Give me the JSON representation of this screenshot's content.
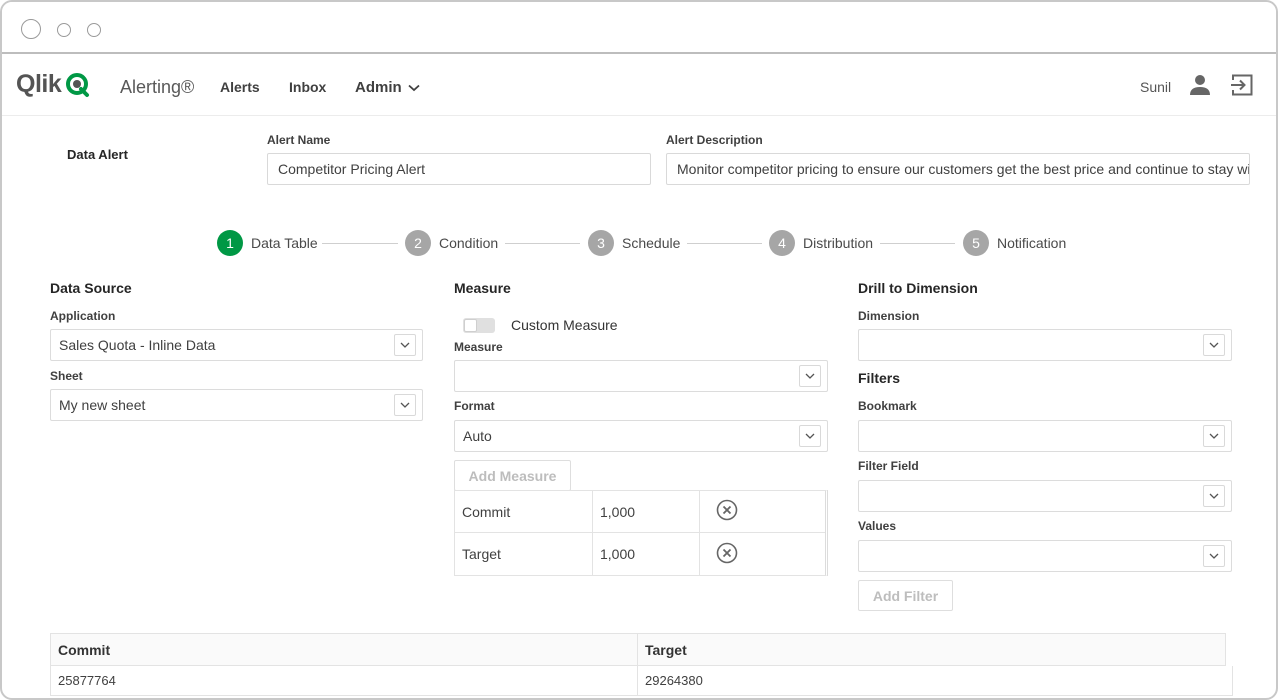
{
  "window": {
    "controls": [
      "close",
      "minimize",
      "maximize"
    ]
  },
  "navbar": {
    "brand": "Qlik",
    "app_name": "Alerting®",
    "links": {
      "alerts": "Alerts",
      "inbox": "Inbox",
      "admin": "Admin"
    },
    "user_name": "Sunil",
    "icons": {
      "user": "user-icon",
      "logout": "logout-icon",
      "admin_chevron": "chevron-down-icon"
    },
    "brand_color": "#009845"
  },
  "alert": {
    "type_label": "Data Alert",
    "name_label": "Alert Name",
    "name_value": "Competitor Pricing Alert",
    "description_label": "Alert Description",
    "description_value": "Monitor competitor pricing to ensure our customers get the best price and continue to stay wi"
  },
  "stepper": {
    "steps": [
      {
        "number": "1",
        "label": "Data Table",
        "active": true
      },
      {
        "number": "2",
        "label": "Condition",
        "active": false
      },
      {
        "number": "3",
        "label": "Schedule",
        "active": false
      },
      {
        "number": "4",
        "label": "Distribution",
        "active": false
      },
      {
        "number": "5",
        "label": "Notification",
        "active": false
      }
    ],
    "active_color": "#009845",
    "inactive_color": "#a6a6a6"
  },
  "data_source": {
    "heading": "Data Source",
    "application_label": "Application",
    "application_value": "Sales Quota - Inline Data",
    "sheet_label": "Sheet",
    "sheet_value": "My new sheet"
  },
  "measure": {
    "heading": "Measure",
    "custom_measure_label": "Custom Measure",
    "custom_measure_on": false,
    "measure_label": "Measure",
    "measure_value": "",
    "format_label": "Format",
    "format_value": "Auto",
    "add_button": "Add Measure",
    "rows": [
      {
        "name": "Commit",
        "value": "1,000"
      },
      {
        "name": "Target",
        "value": "1,000"
      }
    ]
  },
  "drill": {
    "heading": "Drill to Dimension",
    "dimension_label": "Dimension",
    "dimension_value": "",
    "filters_heading": "Filters",
    "bookmark_label": "Bookmark",
    "bookmark_value": "",
    "filter_field_label": "Filter Field",
    "filter_field_value": "",
    "values_label": "Values",
    "values_value": "",
    "add_filter_button": "Add Filter"
  },
  "preview_table": {
    "columns": [
      "Commit",
      "Target"
    ],
    "rows": [
      [
        "25877764",
        "29264380"
      ]
    ]
  }
}
